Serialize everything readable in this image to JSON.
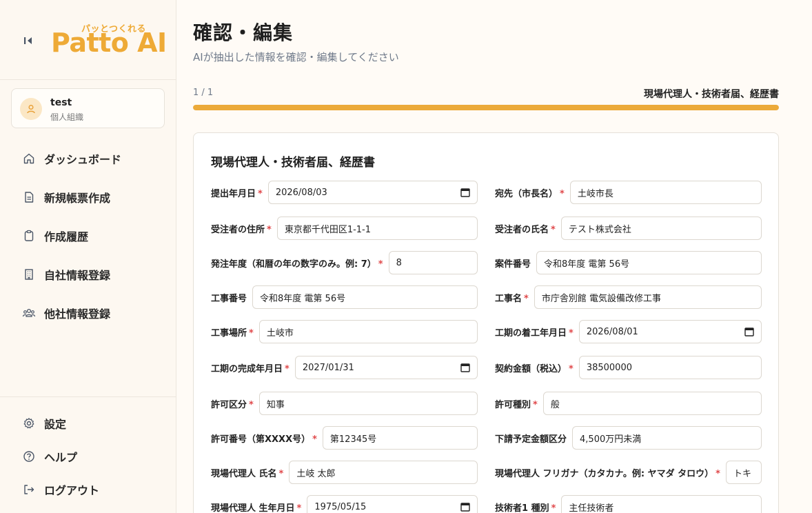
{
  "brand": {
    "tagline": "パッとつくれる",
    "name": "Patto AI",
    "color": "#eeaa36"
  },
  "user": {
    "name": "test",
    "org": "個人組織"
  },
  "nav": [
    {
      "label": "ダッシュボード",
      "icon": "home-icon"
    },
    {
      "label": "新規帳票作成",
      "icon": "document-icon"
    },
    {
      "label": "作成履歴",
      "icon": "clipboard-icon"
    },
    {
      "label": "自社情報登録",
      "icon": "building-icon"
    },
    {
      "label": "他社情報登録",
      "icon": "users-icon"
    }
  ],
  "footer_nav": [
    {
      "label": "設定",
      "icon": "gear-icon"
    },
    {
      "label": "ヘルプ",
      "icon": "help-icon"
    },
    {
      "label": "ログアウト",
      "icon": "logout-icon"
    }
  ],
  "page": {
    "title": "確認・編集",
    "subtitle": "AIが抽出した情報を確認・編集してください",
    "progress_count": "1 / 1",
    "progress_doc": "現場代理人・技術者届、経歴書",
    "progress_fraction": 1.0
  },
  "form": {
    "title": "現場代理人・技術者届、経歴書",
    "fields": [
      {
        "label": "提出年月日",
        "required": true,
        "value": "2026/08/03",
        "type": "date"
      },
      {
        "label": "宛先（市長名）",
        "required": true,
        "value": "土岐市長",
        "type": "text"
      },
      {
        "label": "受注者の住所",
        "required": true,
        "value": "東京都千代田区1-1-1",
        "type": "text"
      },
      {
        "label": "受注者の氏名",
        "required": true,
        "value": "テスト株式会社",
        "type": "text"
      },
      {
        "label": "発注年度（和暦の年の数字のみ。例: 7）",
        "required": true,
        "value": "8",
        "type": "text"
      },
      {
        "label": "案件番号",
        "required": false,
        "value": "令和8年度 電第 56号",
        "type": "text"
      },
      {
        "label": "工事番号",
        "required": false,
        "value": "令和8年度 電第 56号",
        "type": "text"
      },
      {
        "label": "工事名",
        "required": true,
        "value": "市庁舎別館 電気設備改修工事",
        "type": "text"
      },
      {
        "label": "工事場所",
        "required": true,
        "value": "土岐市",
        "type": "text"
      },
      {
        "label": "工期の着工年月日",
        "required": true,
        "value": "2026/08/01",
        "type": "date"
      },
      {
        "label": "工期の完成年月日",
        "required": true,
        "value": "2027/01/31",
        "type": "date"
      },
      {
        "label": "契約金額（税込）",
        "required": true,
        "value": "38500000",
        "type": "text"
      },
      {
        "label": "許可区分",
        "required": true,
        "value": "知事",
        "type": "text"
      },
      {
        "label": "許可種別",
        "required": true,
        "value": "般",
        "type": "text"
      },
      {
        "label": "許可番号（第XXXX号）",
        "required": true,
        "value": "第12345号",
        "type": "text"
      },
      {
        "label": "下請予定金額区分",
        "required": false,
        "value": "4,500万円未満",
        "type": "text"
      },
      {
        "label": "現場代理人 氏名",
        "required": true,
        "value": "土岐 太郎",
        "type": "text"
      },
      {
        "label": "現場代理人 フリガナ（カタカナ。例: ヤマダ タロウ）",
        "required": true,
        "value": "トキ タロウ",
        "type": "text"
      },
      {
        "label": "現場代理人 生年月日",
        "required": true,
        "value": "1975/05/15",
        "type": "date"
      },
      {
        "label": "技術者1 種別",
        "required": true,
        "value": "主任技術者",
        "type": "text"
      }
    ]
  }
}
